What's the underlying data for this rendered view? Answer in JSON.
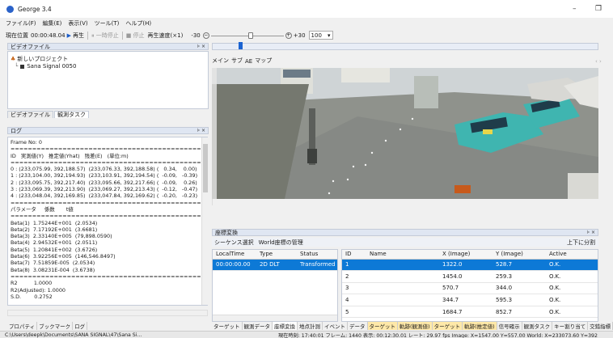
{
  "title": "George 3.4",
  "menu": [
    "ファイル(F)",
    "編集(E)",
    "表示(V)",
    "ツール(T)",
    "ヘルプ(H)"
  ],
  "toolbar": {
    "position_label": "現在位置",
    "position_value": "00:00:48.04",
    "play": "再生",
    "pause": "一時停止",
    "stop": "停止",
    "speed_label": "再生速度(×1)",
    "min": "-30",
    "plus": "+30",
    "zoom": "100"
  },
  "video_panel": {
    "title": "ビデオファイル",
    "project": "新しいプロジェクト",
    "file": "Sana Signal 0050",
    "tabs": [
      "ビデオファイル",
      "観測タスク"
    ]
  },
  "log_panel": {
    "title": "ログ",
    "lines": [
      "Frame No: 0",
      "==================================================",
      "ID   実測値(Y)   推定値(Yhat)   残差(E)   (単位:m)",
      "==================================================",
      "0 : (233,075.99, 392,188.57)  (233,076.33, 392,188.58) (   0.34,    0.00)",
      "1 : (233,104.00, 392,194.93)  (233,103.91, 392,194.54) (  -0.09,   -0.39)",
      "2 : (233,095.75, 392,217.40)  (233,095.66, 392,217.66) (  -0.09,    0.26)",
      "3 : (233,069.39, 392,213.90)  (233,069.27, 392,213.43) (  -0.12,   -0.47)",
      "4 : (233,048.04, 392,169.85)  (233,047.84, 392,169.62) (  -0.20,   -0.23)",
      "==================================================",
      "パラメータ     係数       t値",
      "==================================================",
      "Beta(1)  1.75244E+001  (2.0534)",
      "Beta(2)  7.17192E+001  (3.6681)",
      "Beta(3)  2.33140E+005  (79,898.0590)",
      "Beta(4)  2.94532E+001  (2.0511)",
      "Beta(5)  1.20841E+002  (3.6726)",
      "Beta(6)  3.92256E+005  (146,546.8497)",
      "Beta(7)  7.51859E-005  (2.0534)",
      "Beta(8)  3.08231E-004  (3.6738)",
      "==================================================",
      "R2          1.0000",
      "R2(Adjusted): 1.0000",
      "S.D.        0.2752"
    ]
  },
  "viewer": {
    "tabs": [
      "メイン",
      "サブ",
      "AE",
      "マップ"
    ]
  },
  "coord": {
    "title": "座標変換",
    "subtabs": [
      "シーケンス選択",
      "World座標の管理"
    ],
    "split": "上下に分割",
    "left_headers": [
      "LocalTime",
      "Type",
      "Status"
    ],
    "left_rows": [
      [
        "00:00:00.00",
        "2D DLT",
        "Transformed"
      ]
    ],
    "right_headers": [
      "ID",
      "Name",
      "X (Image)",
      "Y (Image)",
      "Active"
    ],
    "right_rows": [
      [
        "1",
        "",
        "1322.0",
        "528.7",
        "O.K."
      ],
      [
        "2",
        "",
        "1454.0",
        "259.3",
        "O.K."
      ],
      [
        "3",
        "",
        "570.7",
        "344.0",
        "O.K."
      ],
      [
        "4",
        "",
        "344.7",
        "595.3",
        "O.K."
      ],
      [
        "5",
        "",
        "1684.7",
        "852.7",
        "O.K."
      ]
    ]
  },
  "bottom_left_tabs": [
    "プロパティ",
    "ブックマーク",
    "ログ"
  ],
  "bottom_right_tabs": [
    "ターゲット",
    "観測データ",
    "座標変換",
    "地点計測",
    "イベント",
    "データ",
    "ターゲット",
    "軌跡(観測値)",
    "ターゲット",
    "軌跡(推定値)",
    "信号確示",
    "観測タスク",
    "キー割り当て",
    "交錯指標"
  ],
  "status": {
    "path": "C:\\Users\\deepk\\Documents\\SANA SIGNAL\\47\\Sana Si...",
    "info": "現在時刻: 17:40:01  フレーム: 1440  表示: 00:12:30.01  レート: 29.97 fps  Image: X=1547.00 Y=557.00   World: X=233073.60 Y=392"
  }
}
